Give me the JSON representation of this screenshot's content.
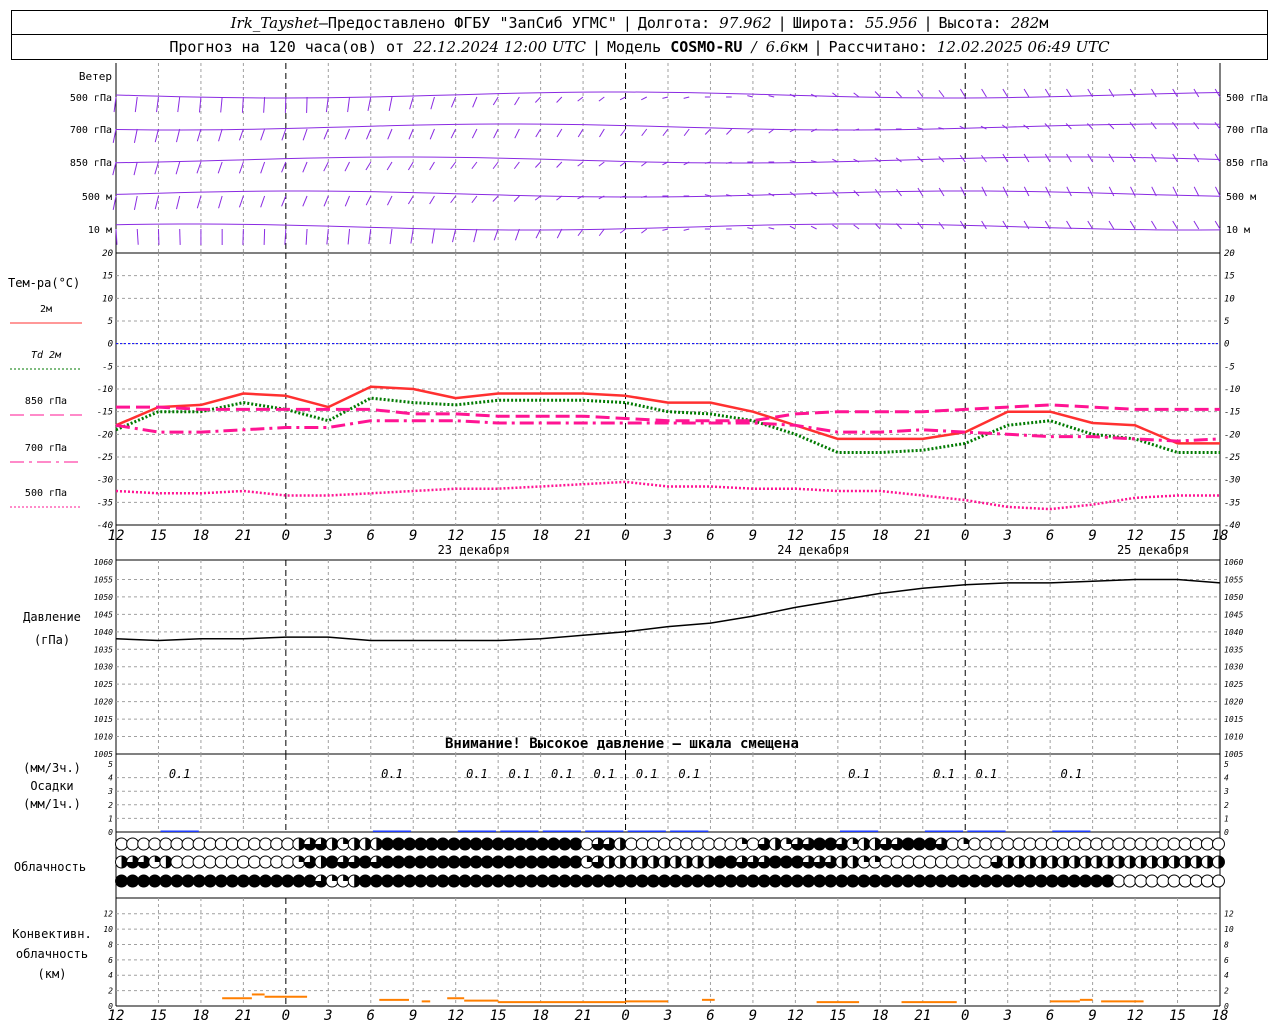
{
  "header": {
    "station": "Irk_Tayshet",
    "dash": " – ",
    "provider": "Предоставлено ФГБУ \"ЗапСиб УГМС\"",
    "lon_label": "Долгота:",
    "lon_value": "97.962",
    "lat_label": "Широта:",
    "lat_value": "55.956",
    "alt_label": "Высота:",
    "alt_value": "282",
    "alt_unit": "м",
    "forecast_label": "Прогноз на 120 часа(ов) от",
    "forecast_time": "22.12.2024 12:00 UTC",
    "model_label": "Модель",
    "model_name": "COSMO-RU",
    "model_res_slash": "/",
    "model_res": "6.6",
    "model_res_unit": "км",
    "calc_label": "Рассчитано:",
    "calc_time": "12.02.2025 06:49 UTC"
  },
  "time_axis": {
    "hours": [
      "12",
      "15",
      "18",
      "21",
      "0",
      "3",
      "6",
      "9",
      "12",
      "15",
      "18",
      "21",
      "0",
      "3",
      "6",
      "9",
      "12",
      "15",
      "18",
      "21",
      "0",
      "3",
      "6",
      "9",
      "12",
      "15",
      "18"
    ],
    "day_labels": [
      {
        "index": 8,
        "text": "23 декабря"
      },
      {
        "index": 16,
        "text": "24 декабря"
      },
      {
        "index": 24,
        "text": "25 декабря"
      }
    ],
    "midnight_indices": [
      4,
      12,
      20
    ]
  },
  "wind_panel": {
    "title": "Ветер",
    "levels": [
      "500 гПа",
      "700 гПа",
      "850 гПа",
      "500 м",
      "10  м"
    ],
    "color": "#8a2be2"
  },
  "temperature_panel": {
    "title": "Тем-ра(°C)",
    "legend": [
      {
        "label": "2м",
        "color": "#ff3030",
        "style": "solid"
      },
      {
        "label": "Td  2м",
        "color": "#007a00",
        "style": "dotted"
      },
      {
        "label": "850 гПа",
        "color": "#ff1493",
        "style": "dashed"
      },
      {
        "label": "700 гПа",
        "color": "#ff1493",
        "style": "dashdot"
      },
      {
        "label": "500 гПа",
        "color": "#ff1493",
        "style": "dotted"
      }
    ],
    "zero_line_color": "#0000ff"
  },
  "pressure_panel": {
    "title": "Давление",
    "unit": "(гПа)",
    "warning": "Внимание! Высокое давление – шкала смещена"
  },
  "precip_panel": {
    "unit_3h": "(мм/3ч.)",
    "title": "Осадки",
    "unit_1h": "(мм/1ч.)",
    "labels": [
      {
        "index": 1.5,
        "text": "0.1"
      },
      {
        "index": 6.5,
        "text": "0.1"
      },
      {
        "index": 8.5,
        "text": "0.1"
      },
      {
        "index": 9.5,
        "text": "0.1"
      },
      {
        "index": 10.5,
        "text": "0.1"
      },
      {
        "index": 11.5,
        "text": "0.1"
      },
      {
        "index": 12.5,
        "text": "0.1"
      },
      {
        "index": 13.5,
        "text": "0.1"
      },
      {
        "index": 17.5,
        "text": "0.1"
      },
      {
        "index": 19.5,
        "text": "0.1"
      },
      {
        "index": 20.5,
        "text": "0.1"
      },
      {
        "index": 22.5,
        "text": "0.1"
      }
    ]
  },
  "cloud_panel": {
    "title": "Облачность",
    "rows": [
      "0000000000000000233212224444444444444444440332000000000010321334431223344430100000000000000000000000",
      "2331200000000000132433434444444444444444441322222222224433344433322110000000000322222222222222222222",
      "4444444444444444443112444444444444444444444444444444444444444444444444444444444444444444440000000000"
    ]
  },
  "convective_panel": {
    "title": "Конвективн.",
    "title2": "облачность",
    "unit": "(км)",
    "color": "#ff7f00"
  },
  "chart_data": [
    {
      "type": "line",
      "title": "Тем-ра(°C)",
      "ylim": [
        -40,
        20
      ],
      "x": [
        0,
        1,
        2,
        3,
        4,
        5,
        6,
        7,
        8,
        9,
        10,
        11,
        12,
        13,
        14,
        15,
        16,
        17,
        18,
        19,
        20,
        21,
        22,
        23,
        24,
        25,
        26
      ],
      "series": [
        {
          "name": "2м",
          "values": [
            -18,
            -14,
            -13.5,
            -11,
            -11.5,
            -14,
            -9.5,
            -10,
            -12,
            -11,
            -11,
            -11,
            -11.5,
            -13,
            -13,
            -15,
            -18,
            -21,
            -21,
            -21,
            -19.5,
            -15,
            -15,
            -17.5,
            -18,
            -22,
            -22
          ]
        },
        {
          "name": "Td  2м",
          "values": [
            -19,
            -15,
            -15,
            -13,
            -14.5,
            -17,
            -12,
            -13,
            -13.5,
            -12.5,
            -12.5,
            -12.5,
            -13,
            -15,
            -15.5,
            -17,
            -20,
            -24,
            -24,
            -23.5,
            -22,
            -18,
            -17,
            -20,
            -21,
            -24,
            -24
          ]
        },
        {
          "name": "850 гПа",
          "values": [
            -14,
            -14,
            -14.5,
            -14.5,
            -14.5,
            -14.5,
            -14.5,
            -15.5,
            -15.5,
            -16,
            -16,
            -16,
            -16.5,
            -17,
            -17,
            -17,
            -15.5,
            -15,
            -15,
            -15,
            -14.5,
            -14,
            -13.5,
            -14,
            -14.5,
            -14.5,
            -14.5
          ]
        },
        {
          "name": "700 гПа",
          "values": [
            -18,
            -19.5,
            -19.5,
            -19,
            -18.5,
            -18.5,
            -17,
            -17,
            -17,
            -17.5,
            -17.5,
            -17.5,
            -17.5,
            -17.5,
            -17.5,
            -17.5,
            -18,
            -19.5,
            -19.5,
            -19,
            -19.5,
            -20,
            -20.5,
            -20.5,
            -21,
            -21.5,
            -21
          ]
        },
        {
          "name": "500 гПа",
          "values": [
            -32.5,
            -33,
            -33,
            -32.5,
            -33.5,
            -33.5,
            -33,
            -32.5,
            -32,
            -32,
            -31.5,
            -31,
            -30.5,
            -31.5,
            -31.5,
            -32,
            -32,
            -32.5,
            -32.5,
            -33.5,
            -34.5,
            -36,
            -36.5,
            -35.5,
            -34,
            -33.5,
            -33.5
          ]
        }
      ]
    },
    {
      "type": "line",
      "title": "Давление",
      "ylabel": "(гПа)",
      "ylim": [
        1005,
        1060
      ],
      "x": [
        0,
        1,
        2,
        3,
        4,
        5,
        6,
        7,
        8,
        9,
        10,
        11,
        12,
        13,
        14,
        15,
        16,
        17,
        18,
        19,
        20,
        21,
        22,
        23,
        24,
        25,
        26
      ],
      "series": [
        {
          "name": "Давление",
          "values": [
            1038,
            1037.5,
            1038,
            1038,
            1038.5,
            1038.5,
            1037.5,
            1037.5,
            1037.5,
            1037.5,
            1038,
            1039,
            1040,
            1041.5,
            1042.5,
            1044.5,
            1047,
            1049,
            1051,
            1052.5,
            1053.5,
            1054,
            1054,
            1054.5,
            1055,
            1055,
            1054
          ]
        }
      ]
    },
    {
      "type": "bar",
      "title": "Осадки",
      "ylim": [
        0,
        5
      ],
      "x": [
        1.5,
        6.5,
        8.5,
        9.5,
        10.5,
        11.5,
        12.5,
        13.5,
        17.5,
        19.5,
        20.5,
        22.5
      ],
      "values": [
        0.1,
        0.1,
        0.1,
        0.1,
        0.1,
        0.1,
        0.1,
        0.1,
        0.1,
        0.1,
        0.1,
        0.1
      ]
    },
    {
      "type": "bar",
      "title": "Конвективн. облачность",
      "ylabel": "(км)",
      "ylim": [
        0,
        13
      ],
      "segments": [
        {
          "x0": 2.5,
          "x1": 3.2,
          "value": 1
        },
        {
          "x0": 3.2,
          "x1": 3.5,
          "value": 1.5
        },
        {
          "x0": 3.5,
          "x1": 4.5,
          "value": 1.2
        },
        {
          "x0": 6.2,
          "x1": 6.9,
          "value": 0.8
        },
        {
          "x0": 7.2,
          "x1": 7.4,
          "value": 0.6
        },
        {
          "x0": 7.8,
          "x1": 8.2,
          "value": 1
        },
        {
          "x0": 8.2,
          "x1": 9,
          "value": 0.7
        },
        {
          "x0": 9,
          "x1": 12,
          "value": 0.5
        },
        {
          "x0": 12,
          "x1": 13,
          "value": 0.6
        },
        {
          "x0": 13.8,
          "x1": 14.1,
          "value": 0.8
        },
        {
          "x0": 16.5,
          "x1": 17.5,
          "value": 0.5
        },
        {
          "x0": 18.5,
          "x1": 19.8,
          "value": 0.5
        },
        {
          "x0": 22,
          "x1": 22.7,
          "value": 0.6
        },
        {
          "x0": 22.7,
          "x1": 23,
          "value": 0.8
        },
        {
          "x0": 23.2,
          "x1": 24.2,
          "value": 0.6
        }
      ]
    }
  ]
}
